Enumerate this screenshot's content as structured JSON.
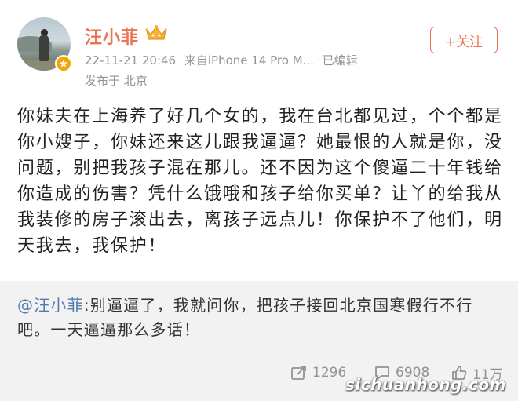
{
  "user": {
    "name": "汪小菲",
    "timestamp": "22-11-21 20:46",
    "source": "来自iPhone 14 Pro M...",
    "edited": "已编辑",
    "location": "发布于 北京"
  },
  "follow_label": "+关注",
  "post": {
    "text": "你妹夫在上海养了好几个女的，我在台北都见过，个个都是你小嫂子，你妹还来这儿跟我逼逼？她最恨的人就是你，没问题，别把我孩子混在那儿。还不因为这个傻逼二十年钱给你造成的伤害？凭什么饿哦和孩子给你买单？让丫的给我从我装修的房子滚出去，离孩子远点儿！你保护不了他们，明天我去，我保护！"
  },
  "repost": {
    "user": "@汪小菲",
    "text": ":别逼逼了，我就问你，把孩子接回北京国寒假行不行吧。一天逼逼那么多话！"
  },
  "actions": {
    "repost_count": "1296",
    "comment_count": "6908",
    "like_count": "11万"
  },
  "watermark": "sichuanhong.com",
  "colors": {
    "accent": "#eb7350",
    "link": "#507daf",
    "meta": "#939393",
    "repost_bg": "#f2f2f2"
  }
}
